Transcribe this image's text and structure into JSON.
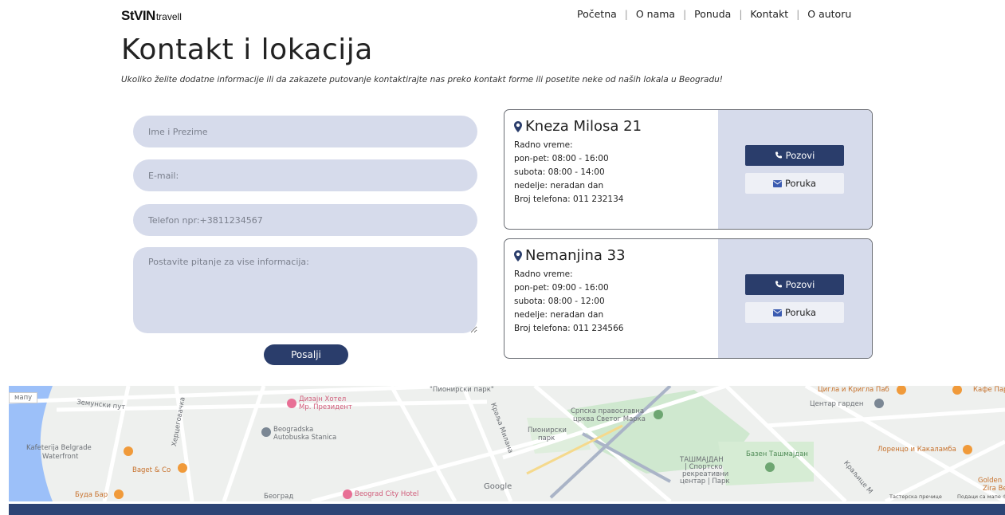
{
  "header": {
    "logo_big": "StVIN",
    "logo_small": "travell",
    "nav": [
      "Početna",
      "O nama",
      "Ponuda",
      "Kontakt",
      "O autoru"
    ]
  },
  "page": {
    "title": "Kontakt i lokacija",
    "subtitle": "Ukoliko želite dodatne informacije ili da zakazete putovanje kontaktirajte nas preko kontakt forme ili posetite neke od naših lokala u Beogradu!"
  },
  "form": {
    "name_placeholder": "Ime i Prezime",
    "email_placeholder": "E-mail:",
    "phone_placeholder": "Telefon npr:+3811234567",
    "message_placeholder": "Postavite pitanje za vise informacija:",
    "submit_label": "Posalji"
  },
  "locations": [
    {
      "address": "Kneza Milosa 21",
      "hours_label": "Radno vreme:",
      "weekdays": "pon-pet: 08:00 - 16:00",
      "saturday": "subota: 08:00 - 14:00",
      "sunday": "nedelje: neradan dan",
      "phone": "Broj telefona: 011 232134",
      "call_label": "Pozovi",
      "message_label": "Poruka"
    },
    {
      "address": "Nemanjina 33",
      "hours_label": "Radno vreme:",
      "weekdays": "pon-pet: 09:00 - 16:00",
      "saturday": "subota: 08:00 - 12:00",
      "sunday": "nedelje: neradan dan",
      "phone": "Broj telefona: 011 234566",
      "call_label": "Pozovi",
      "message_label": "Poruka"
    }
  ],
  "map": {
    "labels": {
      "zemunski": "Земунски пут",
      "kafeterija1": "Kafeterija Belgrade",
      "kafeterija2": "Waterfront",
      "baget": "Baget & Co",
      "buda": "Буда Бар",
      "hotel1": "Дизајн Хотел",
      "hotel2": "Мр. Президент",
      "autobuska1": "Beogradska",
      "autobuska2": "Autobuska Stanica",
      "beograd": "Београд",
      "city_hotel": "Beograd City Hotel",
      "pionirski": "\"Пионирски парк\"",
      "pionirski2a": "Пионирски",
      "pionirski2b": "парк",
      "crkva1": "Српска православна",
      "crkva2": "црква Светог Марка",
      "tasmajdan1": "ТАШМАЈДАН",
      "tasmajdan2": "| Спортско",
      "tasmajdan3": "рекреативни",
      "tasmajdan4": "центар | Парк",
      "bazen": "Базен Ташмајдан",
      "cigla": "Цигла и Кригла Паб",
      "kafe": "Кафе Пар",
      "centar": "Центар гарден",
      "lorenco": "Лоренцо и Какаламба",
      "golden1": "Golden",
      "golden2": "Zira Be",
      "kraljice": "Краљице М",
      "kralja_milana": "Краља Милана",
      "hercegovacka": "Херцеговачка",
      "mapu": "мапу",
      "google": "Google",
      "footer1": "Тастерска пречице",
      "footer2": "Подаци са мапе ©"
    }
  }
}
